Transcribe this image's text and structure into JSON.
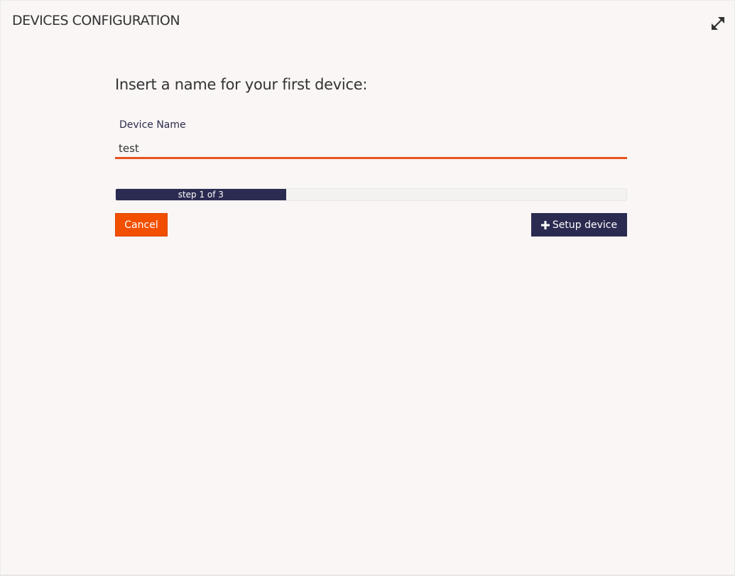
{
  "panel": {
    "title": "DEVICES CONFIGURATION",
    "expand_icon": "expand-arrows-icon"
  },
  "form": {
    "question": "Insert a name for your first device:",
    "device_name_label": "Device Name",
    "device_name_value": "test"
  },
  "progress": {
    "label": "step 1 of 3",
    "current_step": 1,
    "total_steps": 3
  },
  "buttons": {
    "cancel_label": "Cancel",
    "setup_label": "Setup device",
    "setup_icon": "plus-icon"
  },
  "colors": {
    "background": "#f9f6f5",
    "accent_orange": "#f24f00",
    "input_underline": "#e8531f",
    "navy": "#2b2a50",
    "text": "#333333"
  }
}
